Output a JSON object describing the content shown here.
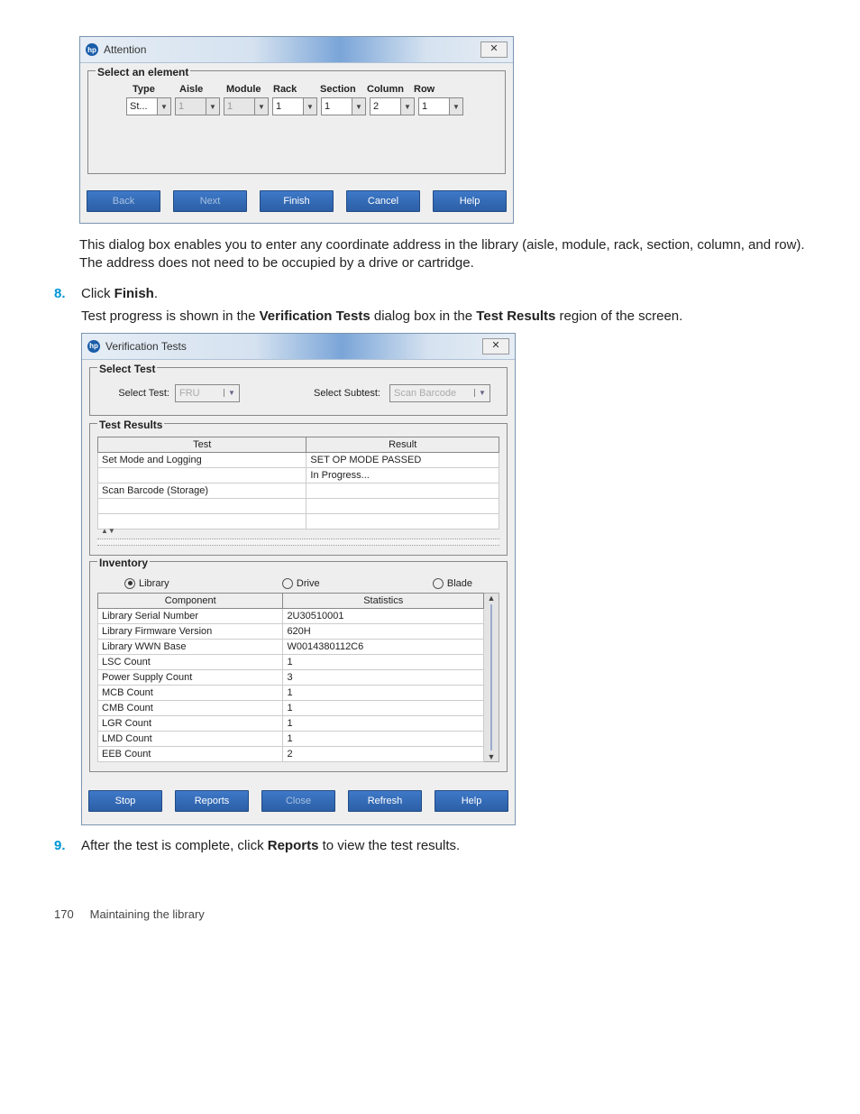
{
  "attention_dialog": {
    "title": "Attention",
    "close_glyph": "✕",
    "fieldset_legend": "Select an element",
    "columns": [
      "Type",
      "Aisle",
      "Module",
      "Rack",
      "Section",
      "Column",
      "Row"
    ],
    "values": {
      "type": "St...",
      "aisle": "1",
      "module": "1",
      "rack": "1",
      "section": "1",
      "column": "2",
      "row": "1"
    },
    "buttons": {
      "back": "Back",
      "next": "Next",
      "finish": "Finish",
      "cancel": "Cancel",
      "help": "Help"
    }
  },
  "para_after_attention": "This dialog box enables you to enter any coordinate address in the library (aisle, module, rack, section, column, and row). The address does not need to be occupied by a drive or cartridge.",
  "step8": {
    "num": "8.",
    "line1_a": "Click ",
    "line1_b": "Finish",
    "line1_c": ".",
    "line2_a": "Test progress is shown in the ",
    "line2_b": "Verification Tests",
    "line2_c": " dialog box in the ",
    "line2_d": "Test Results",
    "line2_e": " region of the screen."
  },
  "verification_dialog": {
    "title": "Verification Tests",
    "close_glyph": "✕",
    "select_test_legend": "Select Test",
    "label_select_test": "Select Test:",
    "value_select_test": "FRU",
    "label_select_subtest": "Select Subtest:",
    "value_select_subtest": "Scan Barcode",
    "test_results_legend": "Test Results",
    "col_test": "Test",
    "col_result": "Result",
    "rows": [
      {
        "test": "Set Mode and Logging",
        "result": "SET OP MODE PASSED"
      },
      {
        "test": "",
        "result": "In Progress..."
      }
    ],
    "tall_label": "Scan Barcode (Storage)",
    "inventory_legend": "Inventory",
    "radios": {
      "library": "Library",
      "drive": "Drive",
      "blade": "Blade"
    },
    "inv_col_component": "Component",
    "inv_col_statistics": "Statistics",
    "inv_rows": [
      {
        "c": "Library Serial Number",
        "s": "2U30510001"
      },
      {
        "c": "Library Firmware Version",
        "s": "620H"
      },
      {
        "c": "Library WWN Base",
        "s": "W0014380112C6"
      },
      {
        "c": "LSC Count",
        "s": "1"
      },
      {
        "c": "Power Supply Count",
        "s": "3"
      },
      {
        "c": "MCB Count",
        "s": "1"
      },
      {
        "c": "CMB Count",
        "s": "1"
      },
      {
        "c": "LGR Count",
        "s": "1"
      },
      {
        "c": "LMD Count",
        "s": "1"
      },
      {
        "c": "EEB Count",
        "s": "2"
      }
    ],
    "buttons": {
      "stop": "Stop",
      "reports": "Reports",
      "close": "Close",
      "refresh": "Refresh",
      "help": "Help"
    }
  },
  "step9": {
    "num": "9.",
    "text_a": "After the test is complete, click ",
    "text_b": "Reports",
    "text_c": " to view the test results."
  },
  "footer": {
    "page_num": "170",
    "section": "Maintaining the library"
  },
  "dd_caret": "▼",
  "scroll_up": "▲",
  "scroll_down": "▼"
}
